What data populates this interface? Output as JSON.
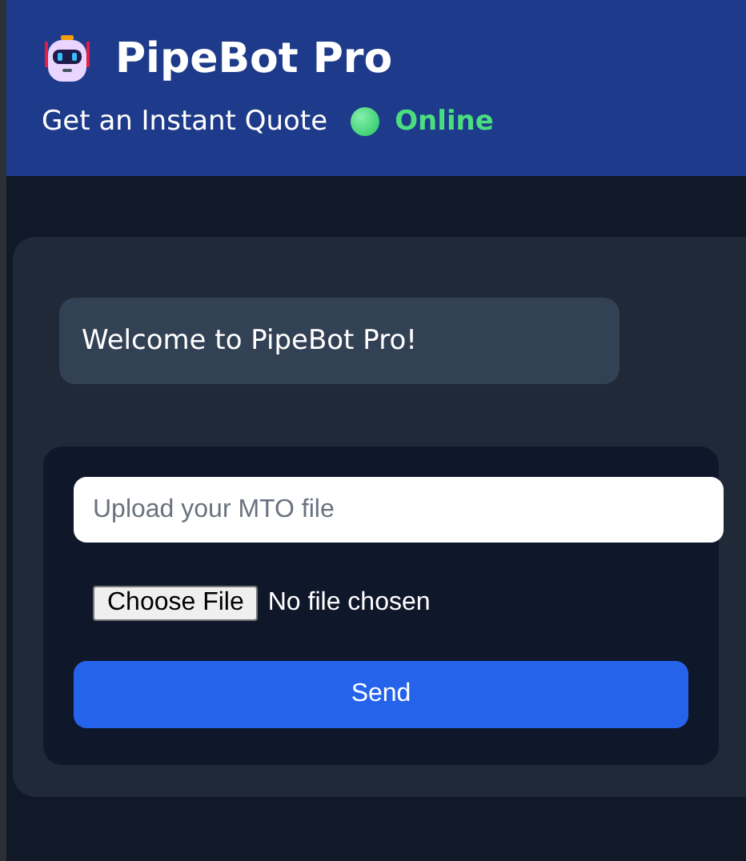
{
  "header": {
    "title": "PipeBot Pro",
    "subtitle": "Get an Instant Quote",
    "status": {
      "label": "Online",
      "online": true
    }
  },
  "chat": {
    "messages": [
      {
        "text": "Welcome to PipeBot Pro!"
      }
    ]
  },
  "form": {
    "file_field": {
      "placeholder": "Upload your MTO file"
    },
    "file_picker": {
      "button": "Choose File",
      "status": "No file chosen"
    },
    "send_button": "Send"
  }
}
